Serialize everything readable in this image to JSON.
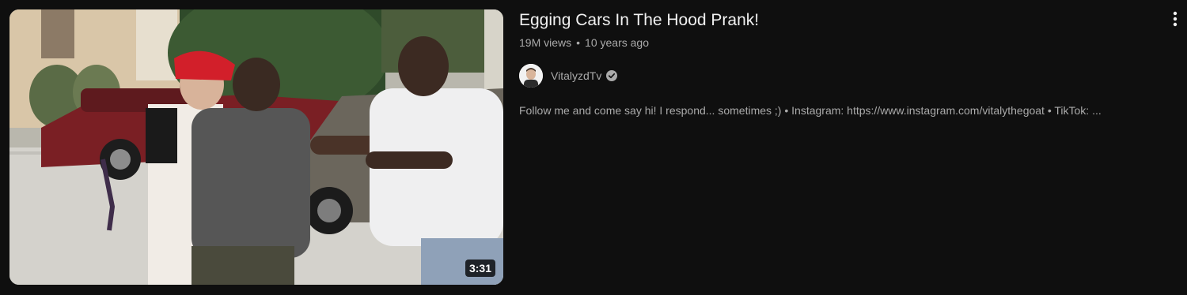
{
  "video": {
    "title": "Egging Cars In The Hood Prank!",
    "views": "19M views",
    "separator": "•",
    "age": "10 years ago",
    "duration": "3:31",
    "thumbnail_icon": "video-thumbnail"
  },
  "channel": {
    "name": "VitalyzdTv",
    "verified_icon": "verified-check-icon",
    "avatar_icon": "channel-avatar"
  },
  "description": "Follow me and come say hi! I respond... sometimes ;) • Instagram: https://www.instagram.com/vitalythegoat • TikTok: ...",
  "actions": {
    "more_icon": "more-vert-icon"
  },
  "colors": {
    "background": "#0f0f0f",
    "title": "#f1f1f1",
    "secondary_text": "#aaaaaa"
  }
}
